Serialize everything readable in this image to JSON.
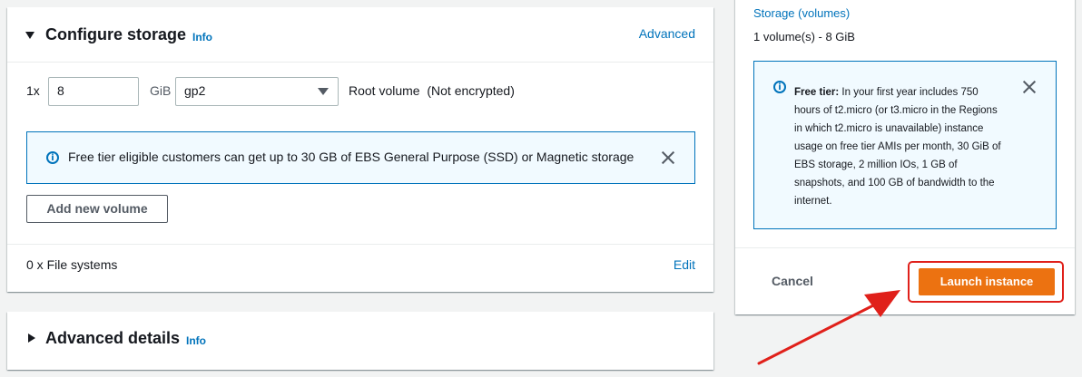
{
  "storage": {
    "title": "Configure storage",
    "info_label": "Info",
    "advanced_link": "Advanced",
    "volume": {
      "count_label": "1x",
      "size_value": "8",
      "unit_label": "GiB",
      "volume_type": "gp2",
      "description": "Root volume  (Not encrypted)"
    },
    "alert_text": "Free tier eligible customers can get up to 30 GB of EBS General Purpose (SSD) or Magnetic storage",
    "add_volume_label": "Add new volume",
    "file_systems_label": "0 x File systems",
    "edit_label": "Edit"
  },
  "advanced": {
    "title": "Advanced details",
    "info_label": "Info"
  },
  "summary": {
    "storage_label": "Storage (volumes)",
    "storage_value": "1 volume(s) - 8 GiB",
    "free_tier_heading": "Free tier:",
    "free_tier_text": "In your first year includes 750 hours of t2.micro (or t3.micro in the Regions in which t2.micro is unavailable) instance usage on free tier AMIs per month, 30 GiB of EBS storage, 2 million IOs, 1 GB of snapshots, and 100 GB of bandwidth to the internet.",
    "cancel_label": "Cancel",
    "launch_label": "Launch instance"
  },
  "colors": {
    "link": "#0073bb",
    "primary_button": "#ec7211",
    "highlight": "#e0201a",
    "alert_bg": "#f1faff"
  },
  "icons": [
    "caret-down-icon",
    "caret-right-icon",
    "info-circle-icon",
    "close-icon",
    "select-chevron-icon"
  ]
}
